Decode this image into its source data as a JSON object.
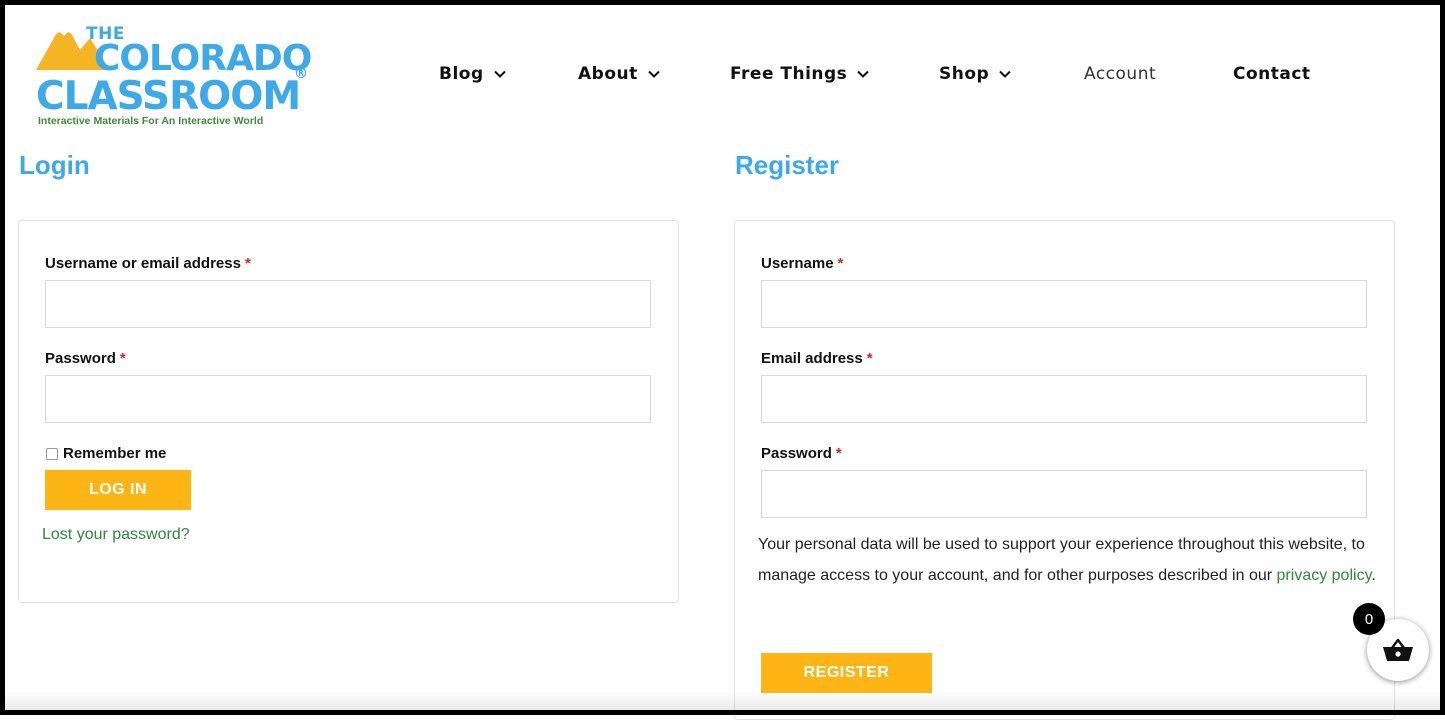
{
  "brand": {
    "the": "THE",
    "line1": "COLORADO",
    "line2": "CLASSROOM",
    "registered": "®",
    "tagline": "Interactive Materials For An Interactive World"
  },
  "nav": [
    {
      "label": "Blog",
      "has_dropdown": true
    },
    {
      "label": "About",
      "has_dropdown": true
    },
    {
      "label": "Free Things",
      "has_dropdown": true
    },
    {
      "label": "Shop",
      "has_dropdown": true
    },
    {
      "label": "Account",
      "has_dropdown": false
    },
    {
      "label": "Contact",
      "has_dropdown": false
    }
  ],
  "login": {
    "title": "Login",
    "username_label": "Username or email address",
    "password_label": "Password",
    "required_mark": "*",
    "username_value": "",
    "password_value": "",
    "remember_label": "Remember me",
    "remember_checked": false,
    "button_label": "LOG IN",
    "lost_password": "Lost your password?"
  },
  "register": {
    "title": "Register",
    "username_label": "Username",
    "email_label": "Email address",
    "password_label": "Password",
    "required_mark": "*",
    "privacy_text_before": "Your personal data will be used to support your experience throughout this website, to manage access to your account, and for other purposes described in our ",
    "privacy_link": "privacy policy",
    "privacy_text_after": ".",
    "button_label": "REGISTER"
  },
  "cart": {
    "count": "0",
    "icon": "basket-icon"
  },
  "colors": {
    "accent_blue": "#3ea9e8",
    "button_yellow": "#fdb515",
    "link_green": "#2f8a3c",
    "required_red": "#d9221c"
  }
}
